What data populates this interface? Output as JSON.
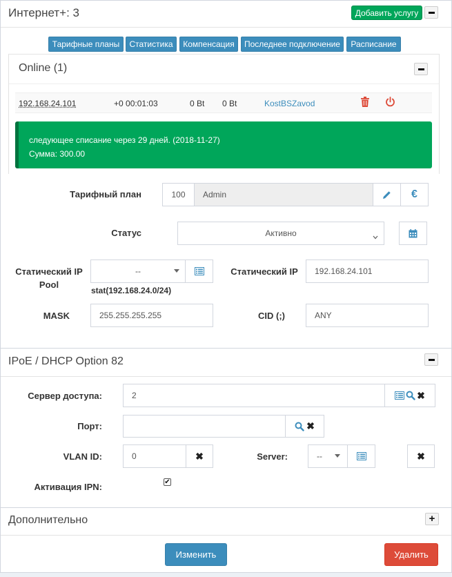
{
  "header": {
    "title": "Интернет+: 3",
    "add_service_label": "Добавить услугу"
  },
  "tabs": [
    {
      "label": "Тарифные планы"
    },
    {
      "label": "Статистика"
    },
    {
      "label": "Компенсация"
    },
    {
      "label": "Последнее подключение"
    },
    {
      "label": "Расписание"
    }
  ],
  "online": {
    "title": "Online (1)",
    "session": {
      "ip": "192.168.24.101",
      "duration": "+0 00:01:03",
      "in": "0 Bt",
      "out": "0 Bt",
      "user": "KostBSZavod"
    }
  },
  "alert": {
    "line1": "следующее списание через 29 дней. (2018-11-27)",
    "line2": "Сумма: 300.00"
  },
  "form": {
    "tariff_label": "Тарифный план",
    "tariff_id": "100",
    "tariff_name": "Admin",
    "status_label": "Статус",
    "status_value": "Активно",
    "static_pool_label": "Статический IP Pool",
    "static_pool_value": "--",
    "static_pool_hint": "stat(192.168.24.0/24)",
    "static_ip_label": "Статический IP",
    "static_ip_value": "192.168.24.101",
    "mask_label": "MASK",
    "mask_value": "255.255.255.255",
    "cid_label": "CID (;)",
    "cid_value": "ANY"
  },
  "ipoe": {
    "title": "IPoE / DHCP Option 82",
    "nas_label": "Сервер доступа:",
    "nas_value": "2",
    "port_label": "Порт:",
    "port_value": "",
    "vlan_label": "VLAN ID:",
    "vlan_value": "0",
    "server_label": "Server:",
    "server_value": "--",
    "ipn_label": "Активация IPN:",
    "ipn_checked": true
  },
  "extra": {
    "title": "Дополнительно"
  },
  "footer": {
    "change_label": "Изменить",
    "delete_label": "Удалить"
  },
  "colors": {
    "primary": "#3c8dbc",
    "success": "#00a65a",
    "danger": "#dd4b39"
  }
}
